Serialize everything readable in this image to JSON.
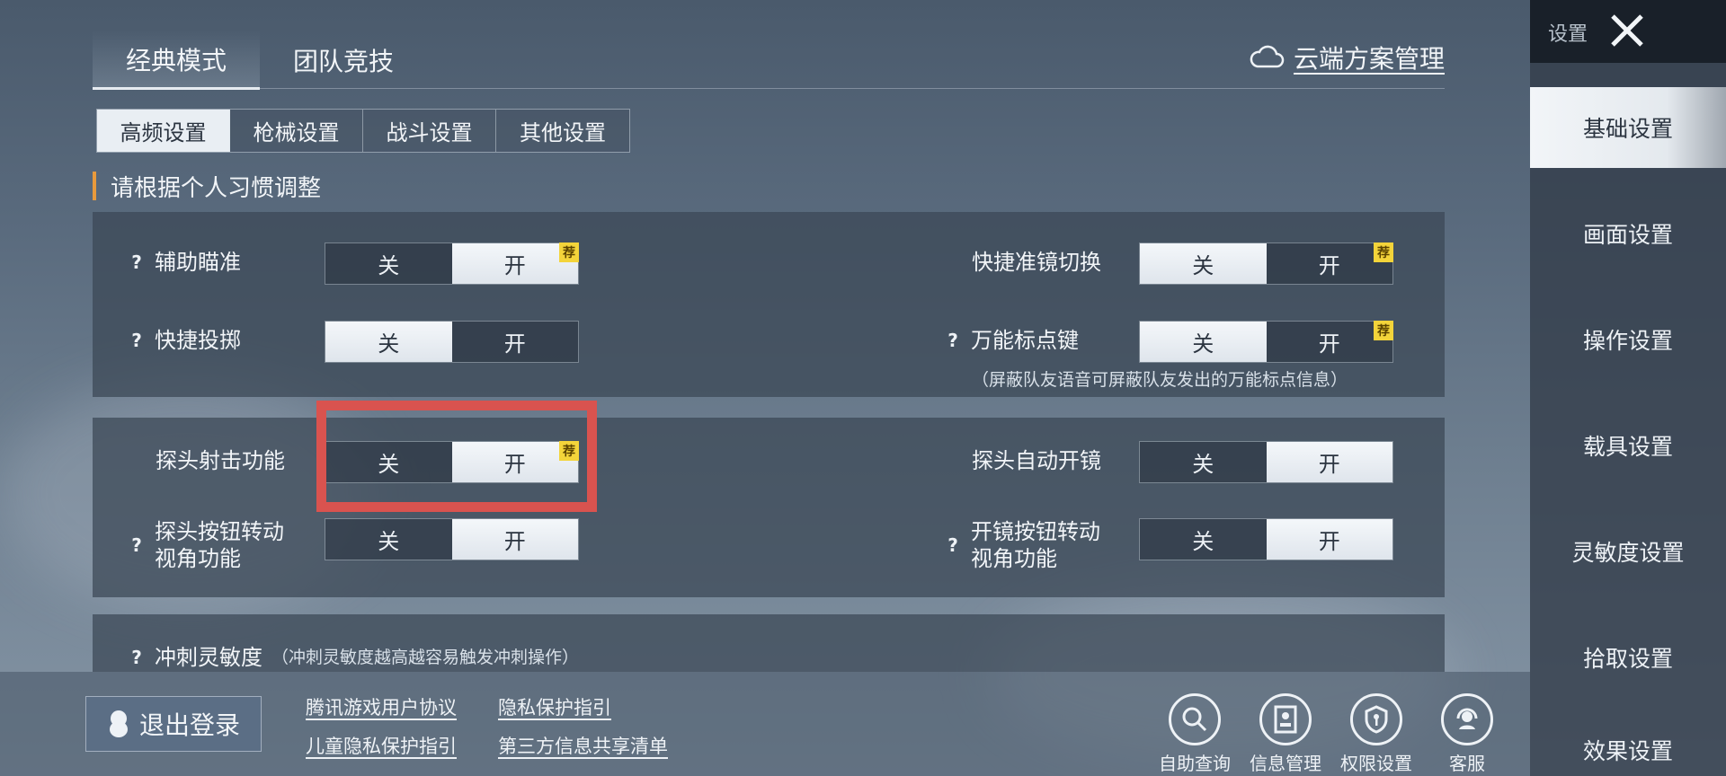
{
  "mode_tabs": [
    "经典模式",
    "团队竞技"
  ],
  "cloud_link": "云端方案管理",
  "sub_tabs": [
    "高频设置",
    "枪械设置",
    "战斗设置",
    "其他设置"
  ],
  "hint": "请根据个人习惯调整",
  "toggle_off": "关",
  "toggle_on": "开",
  "recommend_badge": "荐",
  "settings": {
    "assist_aim": {
      "label": "辅助瞄准",
      "value": "开",
      "recommended": true
    },
    "quick_throw": {
      "label": "快捷投掷",
      "value": "关"
    },
    "quick_scope_switch": {
      "label": "快捷准镜切换",
      "value": "关",
      "recommended": true
    },
    "universal_mark_key": {
      "label": "万能标点键",
      "value": "关",
      "recommended": true,
      "note": "（屏蔽队友语音可屏蔽队友发出的万能标点信息）"
    },
    "peek_fire": {
      "label": "探头射击功能",
      "value": "开",
      "recommended": true
    },
    "peek_auto_scope": {
      "label": "探头自动开镜",
      "value": "开"
    },
    "peek_button_turn": {
      "label_line1": "探头按钮转动",
      "label_line2": "视角功能",
      "value": "开"
    },
    "scope_button_turn": {
      "label_line1": "开镜按钮转动",
      "label_line2": "视角功能",
      "value": "开"
    },
    "sprint_sensitivity": {
      "label": "冲刺灵敏度",
      "note": "（冲刺灵敏度越高越容易触发冲刺操作）"
    }
  },
  "bottom": {
    "logout": "退出登录",
    "links": [
      "腾讯游戏用户协议",
      "隐私保护指引",
      "儿童隐私保护指引",
      "第三方信息共享清单"
    ],
    "tools": [
      "自助查询",
      "信息管理",
      "权限设置",
      "客服"
    ]
  },
  "sidebar": {
    "title": "设置",
    "items": [
      "基础设置",
      "画面设置",
      "操作设置",
      "载具设置",
      "灵敏度设置",
      "拾取设置",
      "效果设置"
    ],
    "active": "基础设置"
  },
  "colors": {
    "highlight": "#d9534f",
    "badge": "#f3d43a",
    "hint_bar": "#e89a3c"
  }
}
